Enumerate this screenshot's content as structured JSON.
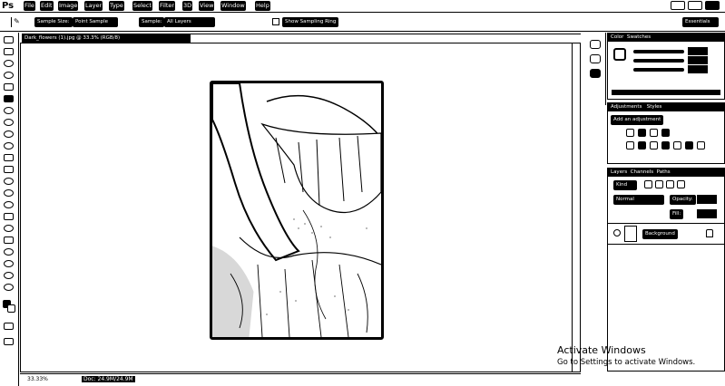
{
  "app": {
    "logo": "Ps"
  },
  "menu": [
    "File",
    "Edit",
    "Image",
    "Layer",
    "Type",
    "Select",
    "Filter",
    "3D",
    "View",
    "Window",
    "Help"
  ],
  "options_bar": {
    "sample_size": "Sample Size:",
    "sample_value": "Point Sample",
    "sample_label": "Sample:",
    "sample_layers": "All Layers",
    "show_ring": "Show Sampling Ring"
  },
  "workspace_button": "Essentials",
  "document": {
    "tab_title": "Dark_flowers (1).jpg @ 33.3% (RGB/8)",
    "zoom": "33.33%",
    "doc_info": "Doc: 24.9M/24.9M"
  },
  "panels": {
    "color_tabs": [
      "Color",
      "Swatches"
    ],
    "adjustments_tabs": [
      "Adjustments",
      "Styles"
    ],
    "add_adjustment": "Add an adjustment",
    "layers_tabs": [
      "Layers",
      "Channels",
      "Paths"
    ],
    "layers_kind": "Kind",
    "blend_mode": "Normal",
    "opacity_label": "Opacity:",
    "fill_label": "Fill:",
    "layer_name": "Background"
  },
  "watermark": {
    "line1": "Activate Windows",
    "line2": "Go to Settings to activate Windows."
  },
  "colors": {
    "accent": "#000000",
    "background": "#ffffff"
  }
}
